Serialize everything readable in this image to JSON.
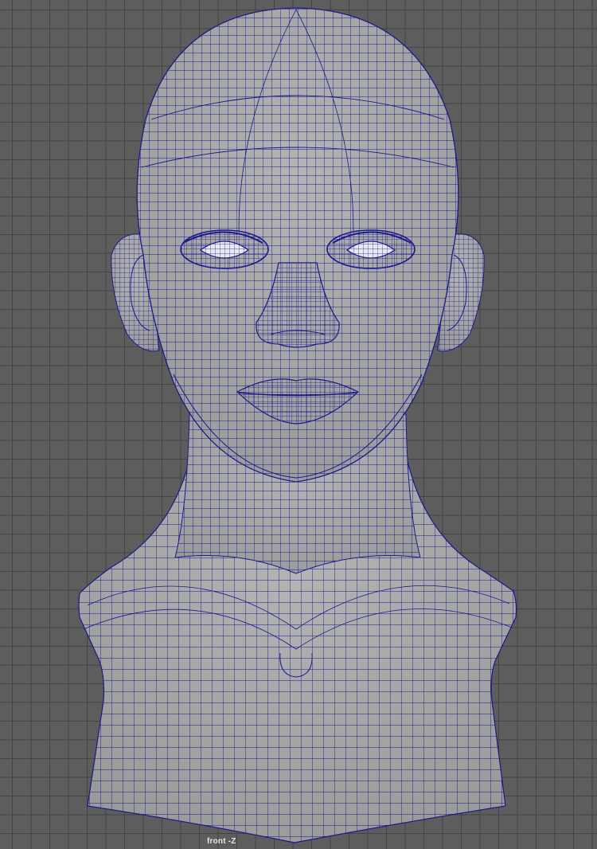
{
  "viewport": {
    "camera_label": "front -Z",
    "background_color": "#5d5d5d",
    "grid_color": "#444444"
  },
  "model": {
    "kind": "head-bust-wireframe",
    "surface_color": "#a8a8a8",
    "wire_color": "#1a1a8c",
    "display_mode": "wireframe-on-shaded"
  }
}
